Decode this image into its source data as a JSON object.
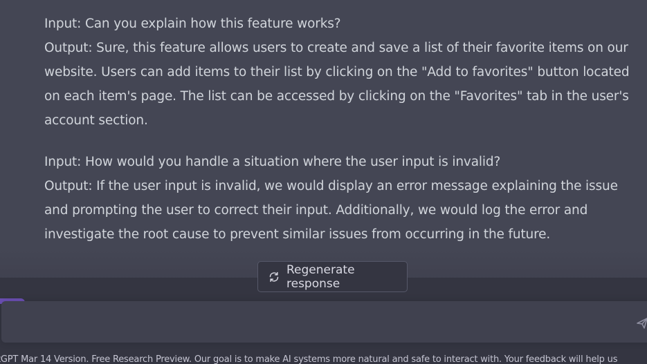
{
  "conversation": {
    "block1": {
      "line1": "Input: Can you explain how this feature works?",
      "line2": "Output: Sure, this feature allows users to create and save a list of their favorite items on our",
      "line3": "website. Users can add items to their list by clicking on the \"Add to favorites\" button located",
      "line4": "on each item's page. The list can be accessed by clicking on the \"Favorites\" tab in the user's",
      "line5": "account section."
    },
    "block2": {
      "line1": "Input: How would you handle a situation where the user input is invalid?",
      "line2": "Output: If the user input is invalid, we would display an error message explaining the issue",
      "line3": "and prompting the user to correct their input. Additionally, we would log the error and",
      "line4": "investigate the root cause to prevent similar issues from occurring in the future."
    }
  },
  "controls": {
    "regenerate_label": "Regenerate response",
    "regenerate_icon": "refresh-icon",
    "send_icon": "send-icon"
  },
  "footer": {
    "text": "tGPT Mar 14 Version. Free Research Preview. Our goal is to make AI systems more natural and safe to interact with. Your feedback will help us"
  },
  "colors": {
    "message_bg": "#444654",
    "page_bg": "#343541",
    "input_bg": "#40414f",
    "accent_purple": "#6b4fb3",
    "text": "#d1d5db"
  }
}
